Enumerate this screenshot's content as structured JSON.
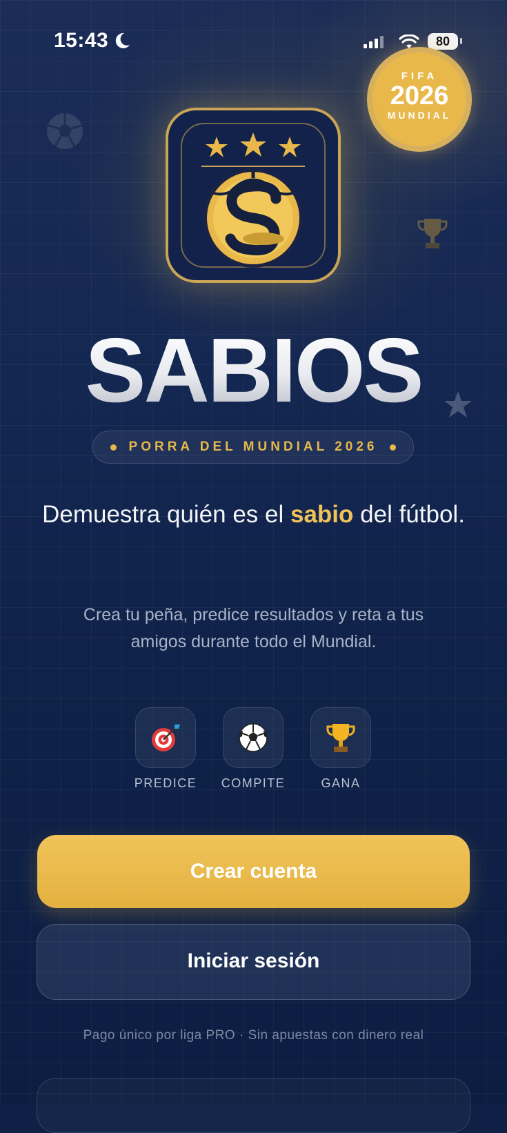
{
  "status_bar": {
    "time": "15:43",
    "battery": "80"
  },
  "badge": {
    "line1": "FIFA",
    "line2": "2026",
    "line3": "MUNDIAL"
  },
  "brand": {
    "title": "SABIOS",
    "subtitle": "PORRA DEL MUNDIAL 2026",
    "accent_color": "#E8B94A"
  },
  "headline": {
    "before": "Demuestra quién es el ",
    "highlight": "sabio",
    "after": " del fútbol."
  },
  "description": "Crea tu peña, predice resultados y reta a tus amigos durante todo el Mundial.",
  "features": [
    {
      "icon": "dart-target-icon",
      "label": "PREDICE"
    },
    {
      "icon": "soccer-ball-icon",
      "label": "COMPITE"
    },
    {
      "icon": "trophy-icon",
      "label": "GANA"
    }
  ],
  "actions": {
    "create_account": "Crear cuenta",
    "sign_in": "Iniciar sesión"
  },
  "footnote": "Pago único por liga PRO · Sin apuestas con dinero real"
}
